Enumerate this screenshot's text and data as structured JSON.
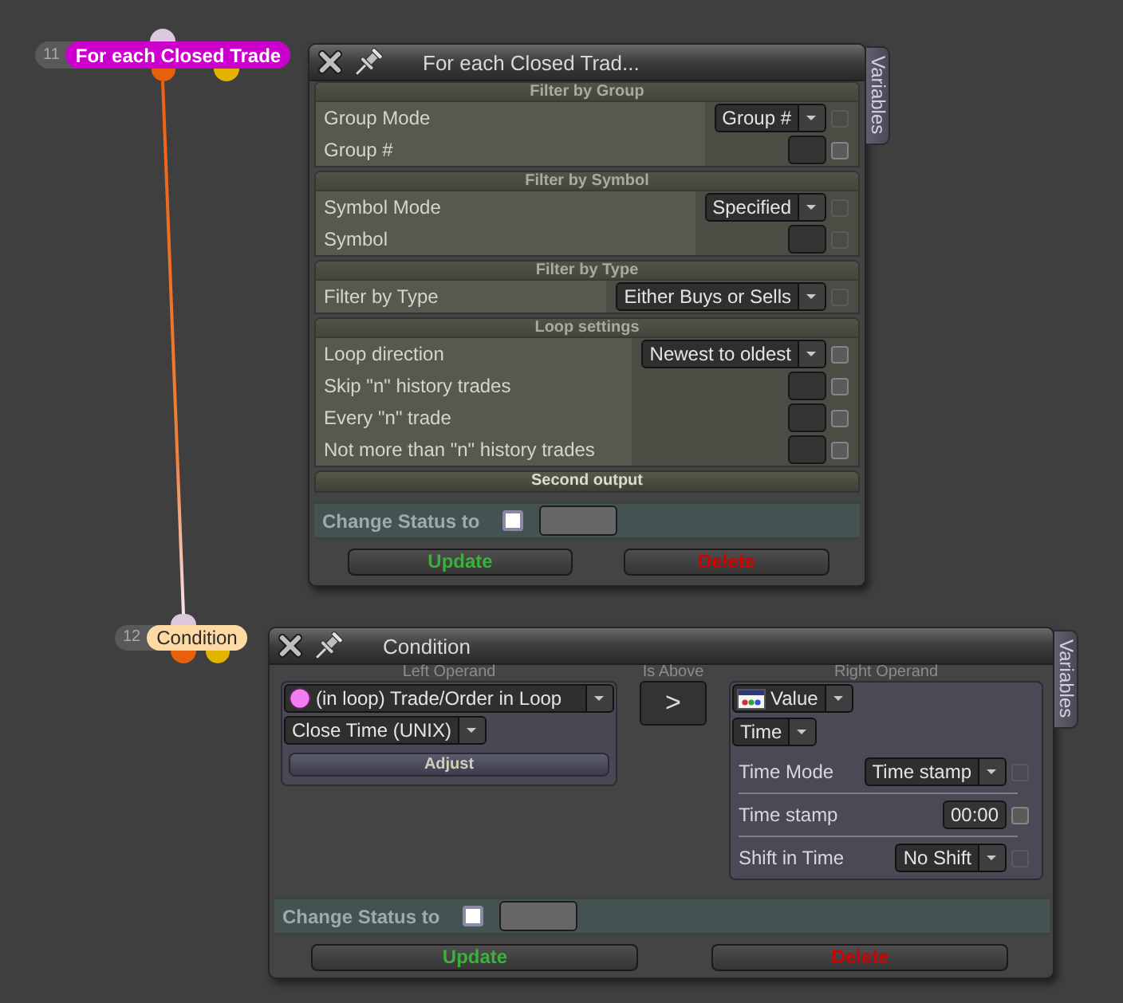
{
  "nodes": [
    {
      "number": "11",
      "label": "For each Closed Trade",
      "color": "#cc00cc"
    },
    {
      "number": "12",
      "label": "Condition",
      "color": "#ffd9a3"
    }
  ],
  "loop_panel": {
    "title": "For each Closed Trad...",
    "side_tab": "Variables",
    "sections": [
      {
        "heading": "Filter by Group",
        "rows": [
          {
            "label": "Group Mode",
            "control": {
              "kind": "dropdown",
              "value": "Group #"
            },
            "checkbox": {
              "checked": false,
              "disabled": true
            }
          },
          {
            "label": "Group #",
            "control": {
              "kind": "input"
            },
            "checkbox": {
              "checked": false,
              "disabled": false
            }
          }
        ]
      },
      {
        "heading": "Filter by Symbol",
        "rows": [
          {
            "label": "Symbol Mode",
            "control": {
              "kind": "dropdown",
              "value": "Specified"
            },
            "checkbox": {
              "checked": false,
              "disabled": true
            }
          },
          {
            "label": "Symbol",
            "control": {
              "kind": "input"
            },
            "checkbox": {
              "checked": false,
              "disabled": true
            }
          }
        ]
      },
      {
        "heading": "Filter by Type",
        "rows": [
          {
            "label": "Filter by Type",
            "control": {
              "kind": "dropdown",
              "value": "Either Buys or Sells"
            },
            "checkbox": {
              "checked": false,
              "disabled": true
            }
          }
        ]
      },
      {
        "heading": "Loop settings",
        "rows": [
          {
            "label": "Loop direction",
            "control": {
              "kind": "dropdown",
              "value": "Newest to oldest"
            },
            "checkbox": {
              "checked": false,
              "disabled": false
            }
          },
          {
            "label": "Skip \"n\" history trades",
            "control": {
              "kind": "input"
            },
            "checkbox": {
              "checked": false,
              "disabled": false
            }
          },
          {
            "label": "Every \"n\" trade",
            "control": {
              "kind": "input"
            },
            "checkbox": {
              "checked": false,
              "disabled": false
            }
          },
          {
            "label": "Not more than \"n\" history trades",
            "control": {
              "kind": "input"
            },
            "checkbox": {
              "checked": false,
              "disabled": false
            }
          }
        ]
      }
    ],
    "second_output": {
      "heading": "Second output"
    },
    "status": {
      "label": "Change Status to",
      "checked": false
    },
    "buttons": [
      {
        "label": "Update",
        "kind": "confirm"
      },
      {
        "label": "Delete",
        "kind": "danger"
      }
    ]
  },
  "condition_panel": {
    "title": "Condition",
    "side_tab": "Variables",
    "left_operand": {
      "heading": "Left Operand",
      "source": "(in loop) Trade/Order in Loop",
      "field": "Close Time (UNIX)",
      "button": "Adjust"
    },
    "operator": {
      "heading": "Is Above",
      "symbol": ">"
    },
    "right_operand": {
      "heading": "Right Operand",
      "source": "Value",
      "type": "Time",
      "rows": [
        {
          "label": "Time Mode",
          "control": {
            "kind": "dropdown",
            "value": "Time stamp"
          },
          "checkbox": {
            "checked": false,
            "disabled": true
          }
        },
        {
          "label": "Time stamp",
          "control": {
            "kind": "input",
            "value": "00:00"
          },
          "checkbox": {
            "checked": false,
            "disabled": false
          }
        },
        {
          "label": "Shift in Time",
          "control": {
            "kind": "dropdown",
            "value": "No Shift"
          },
          "checkbox": {
            "checked": false,
            "disabled": true
          }
        }
      ]
    },
    "status": {
      "label": "Change Status to",
      "checked": false
    },
    "buttons": [
      {
        "label": "Update",
        "kind": "confirm"
      },
      {
        "label": "Delete",
        "kind": "danger"
      }
    ]
  }
}
